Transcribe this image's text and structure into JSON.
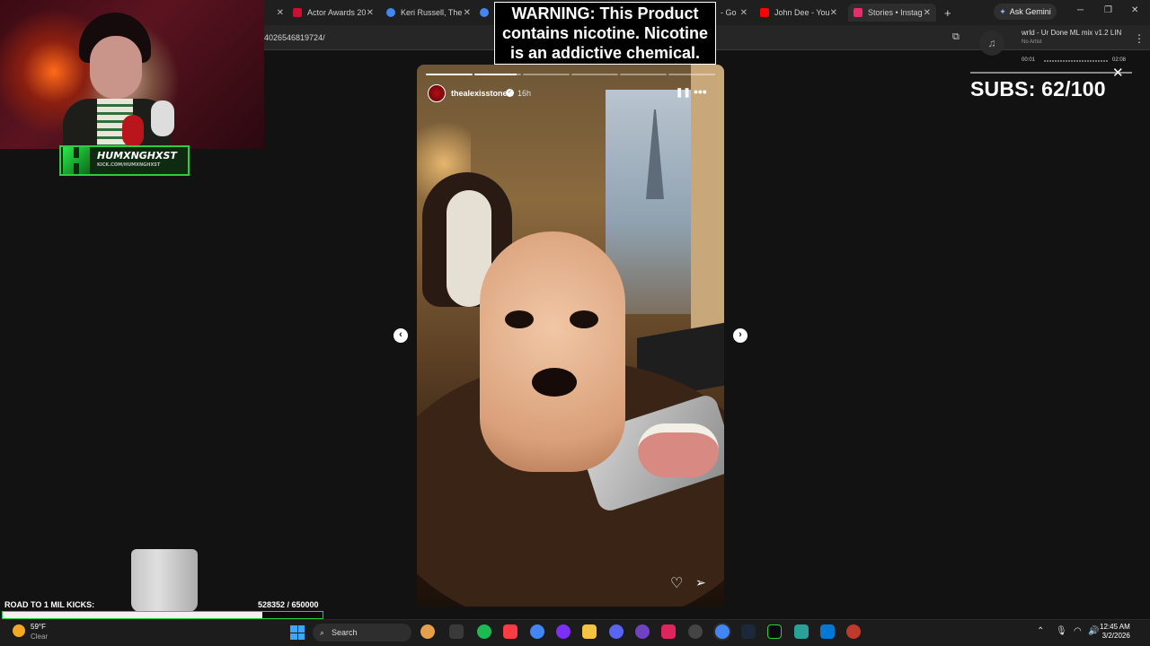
{
  "browser": {
    "tabs": [
      {
        "label": "",
        "color": "#444444"
      },
      {
        "label": "Actor Awards 20",
        "color": "#c41230"
      },
      {
        "label": "Keri Russell, The",
        "color": "#4285f4"
      },
      {
        "label": "",
        "color": "#4285f4"
      },
      {
        "label": "- Go",
        "color": "#4285f4"
      },
      {
        "label": "John Dee - You",
        "color": "#ff0000"
      },
      {
        "label": "Stories • Instag",
        "color": "#e1306c"
      }
    ],
    "new_tab": "+",
    "ask_gemini": "Ask Gemini",
    "url": "4026546819724/"
  },
  "stream": {
    "streamer_name": "HUMXNGHXST",
    "streamer_link": "KICK.COM/HUMXNGHXST",
    "warning": "WARNING: This Product contains nicotine. Nicotine is an addictive chemical.",
    "subs": "SUBS: 62/100",
    "music": {
      "title": "wrld - Ur Done ML mix v1.2 LIN",
      "artist": "No Artist",
      "elapsed": "00:01",
      "duration": "02:08"
    },
    "road_label": "ROAD TO 1 MIL KICKS:",
    "road_count": "528352  / 650000",
    "road_progress": 0.8128
  },
  "story": {
    "username": "thealexisstone",
    "age": "16h",
    "segments_total": 6,
    "segments_done": 1,
    "segment_in_progress": 0.9
  },
  "taskbar": {
    "temperature": "59°F",
    "condition": "Clear",
    "search_label": "Search",
    "time": "12:45 AM",
    "date": "3/2/2026"
  },
  "colors": {
    "accent_green": "#2ecc40",
    "instagram": "#e1306c"
  }
}
